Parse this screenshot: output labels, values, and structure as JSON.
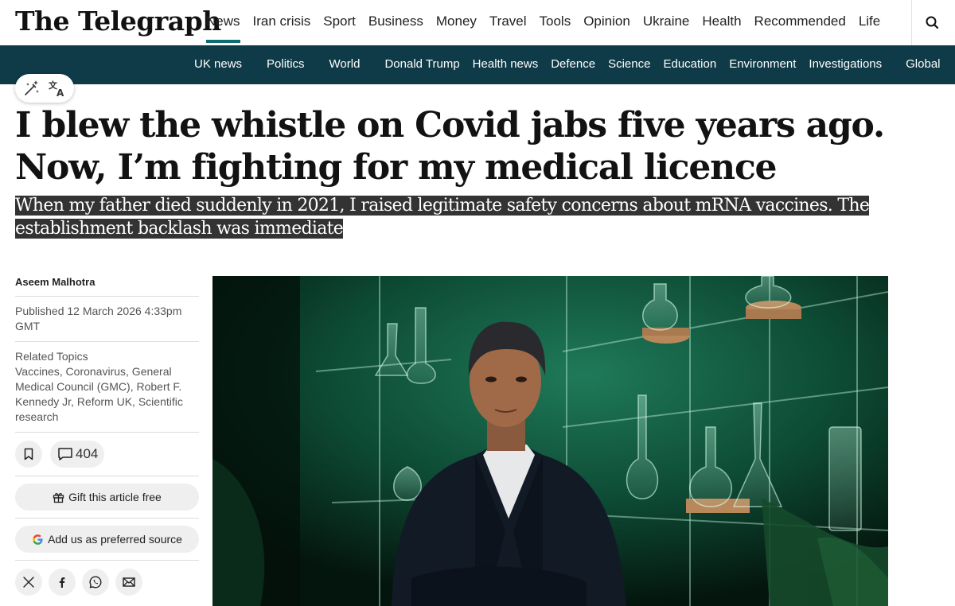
{
  "brand": {
    "logo_text": "The Telegraph"
  },
  "main_nav": {
    "items": [
      {
        "label": "News",
        "active": true
      },
      {
        "label": "Iran crisis"
      },
      {
        "label": "Sport"
      },
      {
        "label": "Business"
      },
      {
        "label": "Money"
      },
      {
        "label": "Travel"
      },
      {
        "label": "Tools"
      },
      {
        "label": "Opinion"
      },
      {
        "label": "Ukraine"
      },
      {
        "label": "Health"
      },
      {
        "label": "Recommended"
      },
      {
        "label": "Life"
      }
    ],
    "search_icon": "search-icon"
  },
  "sub_nav": {
    "items": [
      "UK news",
      "Politics",
      "World",
      "Donald Trump",
      "Health news",
      "Defence",
      "Science",
      "Education",
      "Environment",
      "Investigations",
      "Global"
    ]
  },
  "tool_pill": {
    "icons": [
      "magic-wand-icon",
      "translate-icon"
    ]
  },
  "article": {
    "headline": "I blew the whistle on Covid jabs five years ago. Now, I’m fighting for my medical licence",
    "standfirst": "When my father died suddenly in 2021, I raised legitimate safety concerns about mRNA vaccines. The establishment backlash was immediate",
    "author": "Aseem Malhotra",
    "published": "Published 12 March 2026 4:33pm GMT",
    "related_topics_heading": "Related Topics",
    "related_topics": "Vaccines, Coronavirus, General Medical Council (GMC), Robert F. Kennedy Jr, Reform UK, Scientific research",
    "comment_count": "404",
    "gift_label": "Gift this article free",
    "preferred_source_label": "Add us as preferred source",
    "share_icons": [
      "x-icon",
      "facebook-icon",
      "whatsapp-icon",
      "email-icon"
    ]
  },
  "colors": {
    "accent": "#0e6a73",
    "subnav_bg": "#0f3a47",
    "highlight_bg": "#333333",
    "button_bg": "#efefef"
  }
}
